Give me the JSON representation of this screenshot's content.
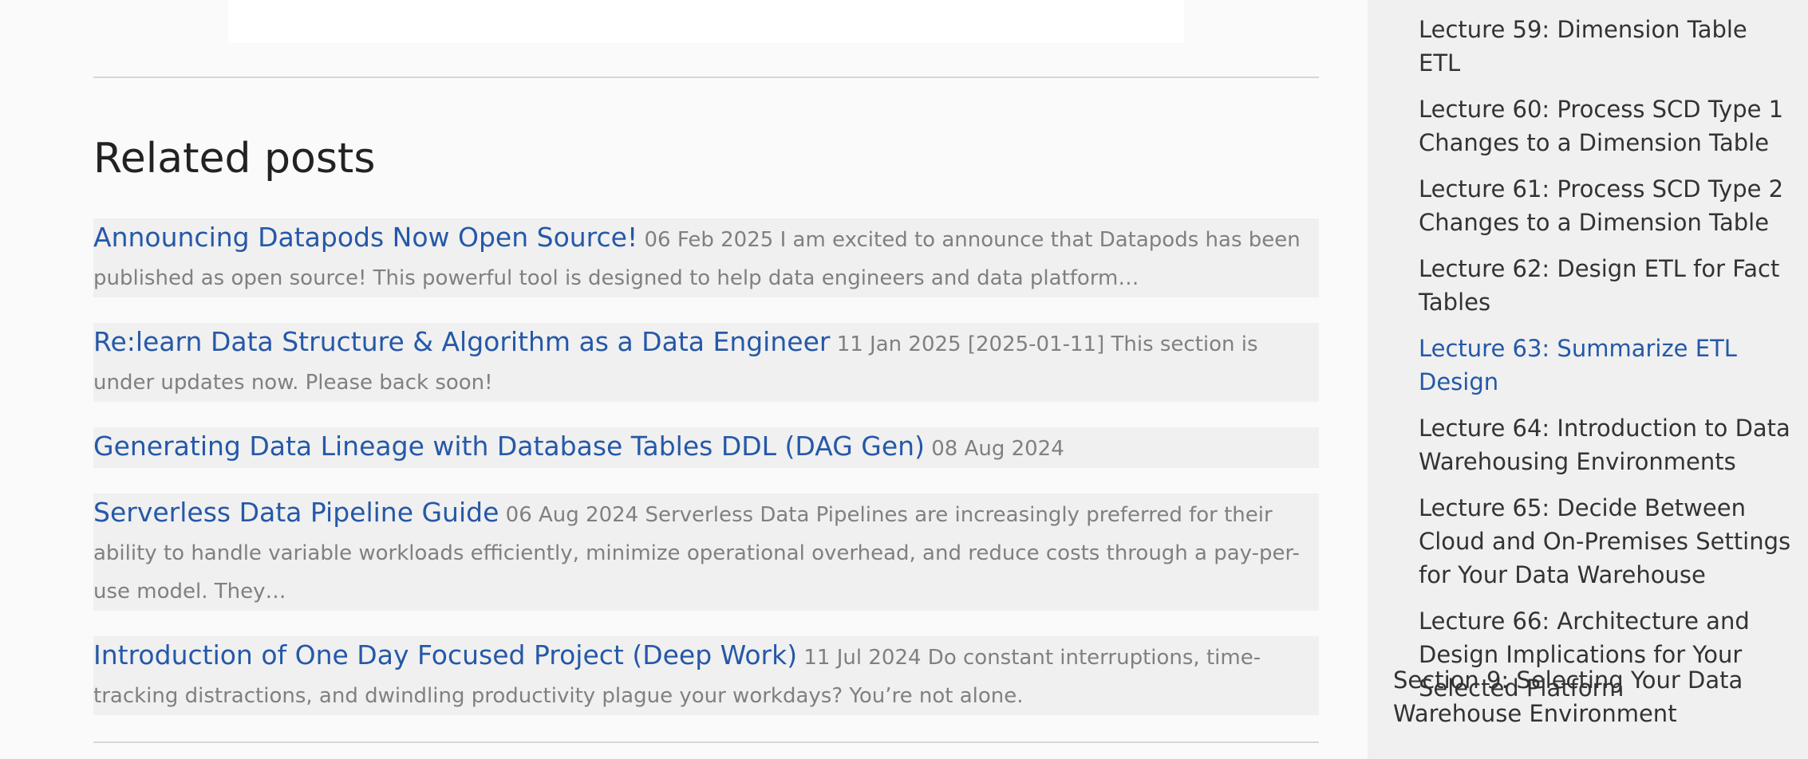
{
  "related": {
    "heading": "Related posts",
    "posts": [
      {
        "title": "Announcing Datapods Now Open Source!",
        "date": "06 Feb 2025",
        "excerpt": "I am excited to announce that Datapods has been published as open source! This powerful tool is designed to help data engineers and data platform…"
      },
      {
        "title": "Re:learn Data Structure & Algorithm as a Data Engineer",
        "date": "11 Jan 2025",
        "excerpt": "[2025-01-11] This section is under updates now. Please back soon!"
      },
      {
        "title": "Generating Data Lineage with Database Tables DDL (DAG Gen)",
        "date": "08 Aug 2024",
        "excerpt": ""
      },
      {
        "title": "Serverless Data Pipeline Guide",
        "date": "06 Aug 2024",
        "excerpt": "Serverless Data Pipelines are increasingly preferred for their ability to handle variable workloads efficiently, minimize operational overhead, and reduce costs through a pay-per-use model. They…"
      },
      {
        "title": "Introduction of One Day Focused Project (Deep Work)",
        "date": "11 Jul 2024",
        "excerpt": "Do constant interruptions, time-tracking distractions, and dwindling productivity plague your workdays? You’re not alone."
      }
    ]
  },
  "sidebar": {
    "lectures": [
      "Lecture 59: Dimension Table ETL",
      "Lecture 60: Process SCD Type 1 Changes to a Dimension Table",
      "Lecture 61: Process SCD Type 2 Changes to a Dimension Table",
      "Lecture 62: Design ETL for Fact Tables",
      "Lecture 63: Summarize ETL Design",
      "Lecture 64: Introduction to Data Warehousing Environments",
      "Lecture 65: Decide Between Cloud and On-Premises Settings for Your Data Warehouse",
      "Lecture 66: Architecture and Design Implications for Your Selected Platform"
    ],
    "active_index": 4,
    "section": "Section 9: Selecting Your Data Warehouse Environment"
  },
  "colors": {
    "link": "#2558a8",
    "meta": "#808080",
    "background": "#fafafa",
    "panel": "#f0f0f0"
  }
}
